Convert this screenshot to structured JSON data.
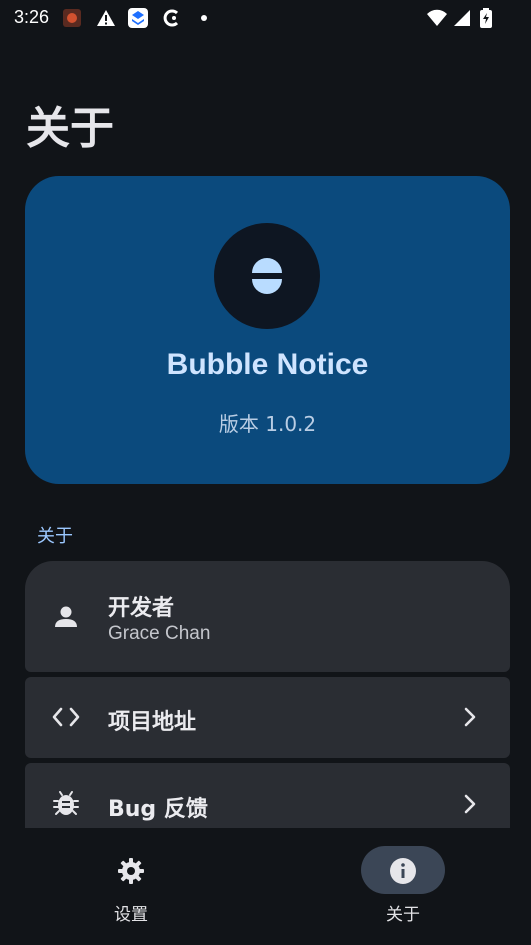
{
  "status_bar": {
    "time": "3:26",
    "icons": [
      "app-notification-icon",
      "warning-icon",
      "app-icon",
      "c-app-icon",
      "dot-icon",
      "wifi-icon",
      "signal-icon",
      "battery-charging-icon"
    ]
  },
  "page": {
    "title": "关于"
  },
  "hero": {
    "app_name": "Bubble Notice",
    "version": "版本 1.0.2",
    "colors": {
      "card": "#0b4a7d",
      "logo_bg": "#0e1622",
      "logo_fg": "#b9dcff"
    }
  },
  "section": {
    "label": "关于"
  },
  "items": [
    {
      "icon": "person-icon",
      "title": "开发者",
      "subtitle": "Grace Chan"
    },
    {
      "icon": "code-icon",
      "title": "项目地址"
    },
    {
      "icon": "bug-icon",
      "title": "Bug 反馈"
    }
  ],
  "nav": {
    "items": [
      {
        "icon": "gear-icon",
        "label": "设置",
        "active": false
      },
      {
        "icon": "info-icon",
        "label": "关于",
        "active": true
      }
    ]
  }
}
